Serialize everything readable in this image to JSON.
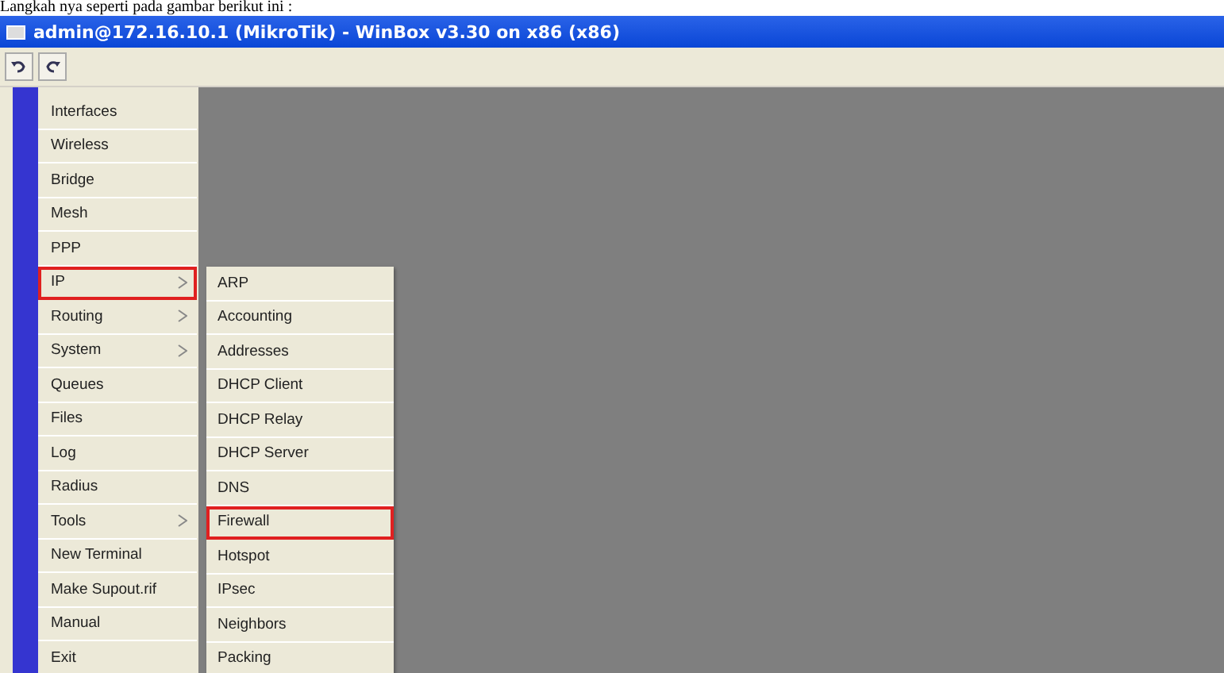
{
  "caption": "Langkah nya seperti pada gambar berikut ini :",
  "window": {
    "title": "admin@172.16.10.1 (MikroTik) - WinBox v3.30 on x86 (x86)"
  },
  "menu": [
    {
      "label": "Interfaces",
      "has_submenu": false,
      "highlighted": false
    },
    {
      "label": "Wireless",
      "has_submenu": false,
      "highlighted": false
    },
    {
      "label": "Bridge",
      "has_submenu": false,
      "highlighted": false
    },
    {
      "label": "Mesh",
      "has_submenu": false,
      "highlighted": false
    },
    {
      "label": "PPP",
      "has_submenu": false,
      "highlighted": false
    },
    {
      "label": "IP",
      "has_submenu": true,
      "highlighted": true
    },
    {
      "label": "Routing",
      "has_submenu": true,
      "highlighted": false
    },
    {
      "label": "System",
      "has_submenu": true,
      "highlighted": false
    },
    {
      "label": "Queues",
      "has_submenu": false,
      "highlighted": false
    },
    {
      "label": "Files",
      "has_submenu": false,
      "highlighted": false
    },
    {
      "label": "Log",
      "has_submenu": false,
      "highlighted": false
    },
    {
      "label": "Radius",
      "has_submenu": false,
      "highlighted": false
    },
    {
      "label": "Tools",
      "has_submenu": true,
      "highlighted": false
    },
    {
      "label": "New Terminal",
      "has_submenu": false,
      "highlighted": false
    },
    {
      "label": "Make Supout.rif",
      "has_submenu": false,
      "highlighted": false
    },
    {
      "label": "Manual",
      "has_submenu": false,
      "highlighted": false
    },
    {
      "label": "Exit",
      "has_submenu": false,
      "highlighted": false
    }
  ],
  "submenu": [
    {
      "label": "ARP",
      "highlighted": false
    },
    {
      "label": "Accounting",
      "highlighted": false
    },
    {
      "label": "Addresses",
      "highlighted": false
    },
    {
      "label": "DHCP Client",
      "highlighted": false
    },
    {
      "label": "DHCP Relay",
      "highlighted": false
    },
    {
      "label": "DHCP Server",
      "highlighted": false
    },
    {
      "label": "DNS",
      "highlighted": false
    },
    {
      "label": "Firewall",
      "highlighted": true
    },
    {
      "label": "Hotspot",
      "highlighted": false
    },
    {
      "label": "IPsec",
      "highlighted": false
    },
    {
      "label": "Neighbors",
      "highlighted": false
    },
    {
      "label": "Packing",
      "highlighted": false
    }
  ]
}
